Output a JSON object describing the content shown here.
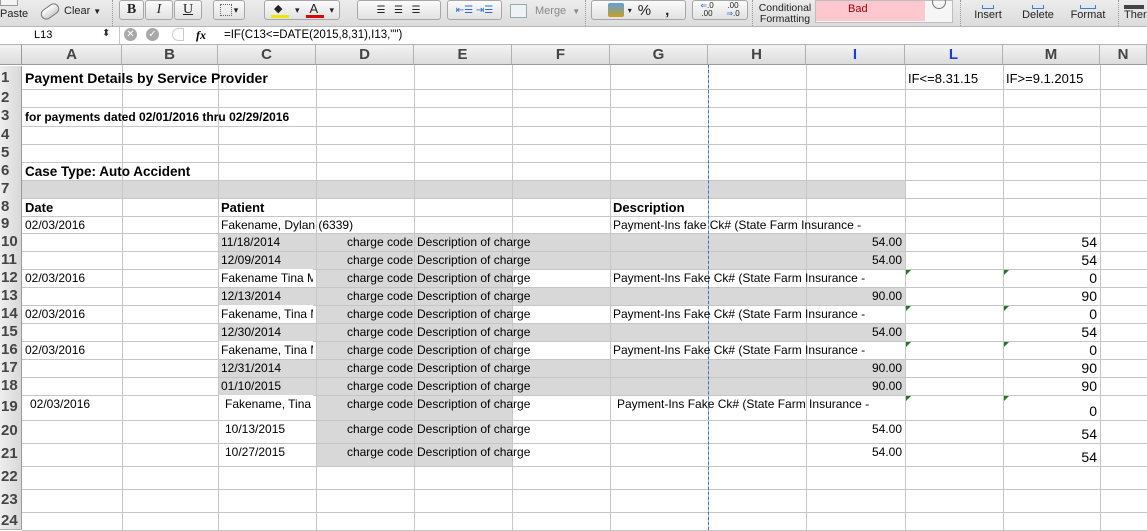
{
  "ribbon": {
    "paste_label": "Paste",
    "clear_label": "Clear",
    "bold_label": "B",
    "italic_label": "I",
    "underline_label": "U",
    "fill_color": "#f2e600",
    "font_color": "#e00000",
    "merge_label": "Merge",
    "percent_label": "%",
    "comma_label": ",",
    "increase_decimal_label": ".00",
    "decrease_decimal_label": ".0",
    "conditional_formatting_label_1": "Conditional",
    "conditional_formatting_label_2": "Formatting",
    "style_bad_label": "Bad",
    "style_bad_bg": "#ffc7ce",
    "style_bad_fg": "#9c0006",
    "insert_label": "Insert",
    "delete_label": "Delete",
    "format_label": "Format",
    "themes_label": "Ther"
  },
  "formula_bar": {
    "cell_ref": "L13",
    "fx_label": "fx",
    "formula": "=IF(C13<=DATE(2015,8,31),I13,\"\")"
  },
  "columns": [
    "A",
    "B",
    "C",
    "D",
    "E",
    "F",
    "G",
    "H",
    "I",
    "L",
    "M",
    "N"
  ],
  "rows": [
    "1",
    "2",
    "3",
    "4",
    "5",
    "6",
    "7",
    "8",
    "9",
    "10",
    "11",
    "12",
    "13",
    "14",
    "15",
    "16",
    "17",
    "18",
    "19",
    "20",
    "21",
    "22",
    "23",
    "24"
  ],
  "sheet": {
    "title": "Payment Details by Service Provider",
    "subtitle": "for payments dated 02/01/2016 thru 02/29/2016",
    "case_type": "Case Type: Auto Accident",
    "l1": "IF<=8.31.15",
    "m1": "IF>=9.1.2015",
    "headers": {
      "date": "Date",
      "patient": "Patient",
      "description": "Description"
    },
    "lines": [
      {
        "row": 9,
        "date": "02/03/2016",
        "patient": "Fakename, Dylan  (6339)",
        "code": "",
        "desc": "",
        "payment": "Payment-Ins fake Ck# (State Farm Insurance -",
        "amount": "",
        "l": "",
        "m": ""
      },
      {
        "row": 10,
        "date": "",
        "patient": "11/18/2014",
        "code": "charge code",
        "desc": "Description of charge",
        "payment": "",
        "amount": "54.00",
        "l": "",
        "m": "54"
      },
      {
        "row": 11,
        "date": "",
        "patient": "12/09/2014",
        "code": "charge code",
        "desc": "Description of charge",
        "payment": "",
        "amount": "54.00",
        "l": "",
        "m": "54"
      },
      {
        "row": 12,
        "date": "02/03/2016",
        "patient": "Fakename Tina M",
        "code": "charge code",
        "desc": "Description of charge",
        "payment": "Payment-Ins Fake Ck# (State Farm Insurance -",
        "amount": "",
        "l": "",
        "m": "0"
      },
      {
        "row": 13,
        "date": "",
        "patient": "12/13/2014",
        "code": "charge code",
        "desc": "Description of charge",
        "payment": "",
        "amount": "90.00",
        "l": "",
        "m": "90"
      },
      {
        "row": 14,
        "date": "02/03/2016",
        "patient": "Fakename, Tina M",
        "code": "charge code",
        "desc": "Description of charge",
        "payment": "Payment-Ins Fake Ck# (State Farm Insurance -",
        "amount": "",
        "l": "",
        "m": "0"
      },
      {
        "row": 15,
        "date": "",
        "patient": "12/30/2014",
        "code": "charge code",
        "desc": "Description of charge",
        "payment": "",
        "amount": "54.00",
        "l": "",
        "m": "54"
      },
      {
        "row": 16,
        "date": "02/03/2016",
        "patient": "Fakename, Tina M",
        "code": "charge code",
        "desc": "Description of charge",
        "payment": "Payment-Ins Fake Ck# (State Farm Insurance -",
        "amount": "",
        "l": "",
        "m": "0"
      },
      {
        "row": 17,
        "date": "",
        "patient": "12/31/2014",
        "code": "charge code",
        "desc": "Description of charge",
        "payment": "",
        "amount": "90.00",
        "l": "",
        "m": "90"
      },
      {
        "row": 18,
        "date": "",
        "patient": "01/10/2015",
        "code": "charge code",
        "desc": "Description of charge",
        "payment": "",
        "amount": "90.00",
        "l": "",
        "m": "90"
      },
      {
        "row": 19,
        "date": "02/03/2016",
        "patient": "Fakename, Tina M",
        "code": "charge code",
        "desc": "Description of charge",
        "payment": "Payment-Ins Fake Ck# (State Farm Insurance -",
        "amount": "",
        "l": "",
        "m": "0"
      },
      {
        "row": 20,
        "date": "",
        "patient": "10/13/2015",
        "code": "charge code",
        "desc": "Description of charge",
        "payment": "",
        "amount": "54.00",
        "l": "",
        "m": "54"
      },
      {
        "row": 21,
        "date": "",
        "patient": "10/27/2015",
        "code": "charge code",
        "desc": "Description of charge",
        "payment": "",
        "amount": "54.00",
        "l": "",
        "m": "54"
      }
    ]
  }
}
